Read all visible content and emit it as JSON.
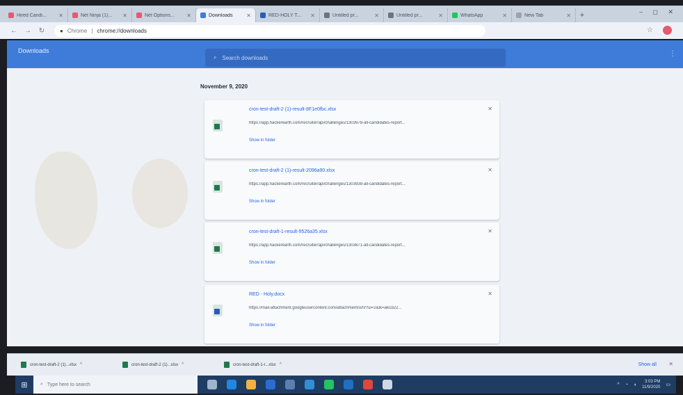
{
  "browser": {
    "tabs": [
      {
        "label": "Hired Candi...",
        "color": "#e35b6d",
        "active": false
      },
      {
        "label": "Net Ninja (1)...",
        "color": "#e35b6d",
        "active": false
      },
      {
        "label": "Net Options...",
        "color": "#e35b6d",
        "active": false
      },
      {
        "label": "Downloads",
        "color": "#3f7bd8",
        "active": true
      },
      {
        "label": "RED-HOLY T...",
        "color": "#2b5bb5",
        "active": false
      },
      {
        "label": "Untitled pr...",
        "color": "#6b7280",
        "active": false
      },
      {
        "label": "Untitled pr...",
        "color": "#6b7280",
        "active": false
      },
      {
        "label": "WhatsApp",
        "color": "#22c55e",
        "active": false
      },
      {
        "label": "New Tab",
        "color": "#9ca3af",
        "active": false
      }
    ],
    "address": {
      "scheme": "Chrome",
      "path": "chrome://downloads"
    }
  },
  "downloads": {
    "title": "Downloads",
    "search_placeholder": "Search downloads",
    "date_heading": "November 9, 2020",
    "items": [
      {
        "filename": "cron-test-draft-2 (1)-result-8F1e0fbc.xlsx",
        "url": "https://app.hackerearth.com/recruiter/api/challenges/1303978-all-candidates-report...",
        "action": "Show in folder",
        "type": "xlsx"
      },
      {
        "filename": "cron-test-draft-2 (1)-result-2096a90.xlsx",
        "url": "https://app.hackerearth.com/recruiter/api/challenges/1303938-all-candidates-report...",
        "action": "Show in folder",
        "type": "xlsx"
      },
      {
        "filename": "cron-test-draft-1-result-9526a35.xlsx",
        "url": "https://app.hackerearth.com/recruiter/api/challenges/1303871-all-candidates-report...",
        "action": "Show in folder",
        "type": "xlsx"
      },
      {
        "filename": "RED - Holy.docx",
        "url": "https://mail-attachment.googleusercontent.com/attachment/u/0/?ui=2&ik=a61b22...",
        "action": "Show in folder",
        "type": "docx"
      }
    ]
  },
  "shelf": {
    "items": [
      {
        "label": "cron-test-draft-2 (1)...xlsx"
      },
      {
        "label": "cron-test-draft-2 (1)...xlsx"
      },
      {
        "label": "cron-test-draft-1-r...xlsx"
      }
    ],
    "show_all": "Show all"
  },
  "taskbar": {
    "search_placeholder": "Type here to search",
    "apps": [
      {
        "name": "task-view",
        "color": "#9fb3cc"
      },
      {
        "name": "edge",
        "color": "#1e88e5"
      },
      {
        "name": "file-explorer",
        "color": "#f2b33d"
      },
      {
        "name": "mail",
        "color": "#2b6cd1"
      },
      {
        "name": "store",
        "color": "#5c7fb0"
      },
      {
        "name": "vscode",
        "color": "#2f8fd8"
      },
      {
        "name": "whatsapp",
        "color": "#22c55e"
      },
      {
        "name": "vscode-blue",
        "color": "#1f6fc2"
      },
      {
        "name": "chrome",
        "color": "#e3453b"
      },
      {
        "name": "settings",
        "color": "#cfd8e3"
      }
    ],
    "clock_time": "3:03 PM",
    "clock_date": "11/9/2020"
  },
  "colors": {
    "accent": "#3f7bd8",
    "link": "#2563eb"
  }
}
